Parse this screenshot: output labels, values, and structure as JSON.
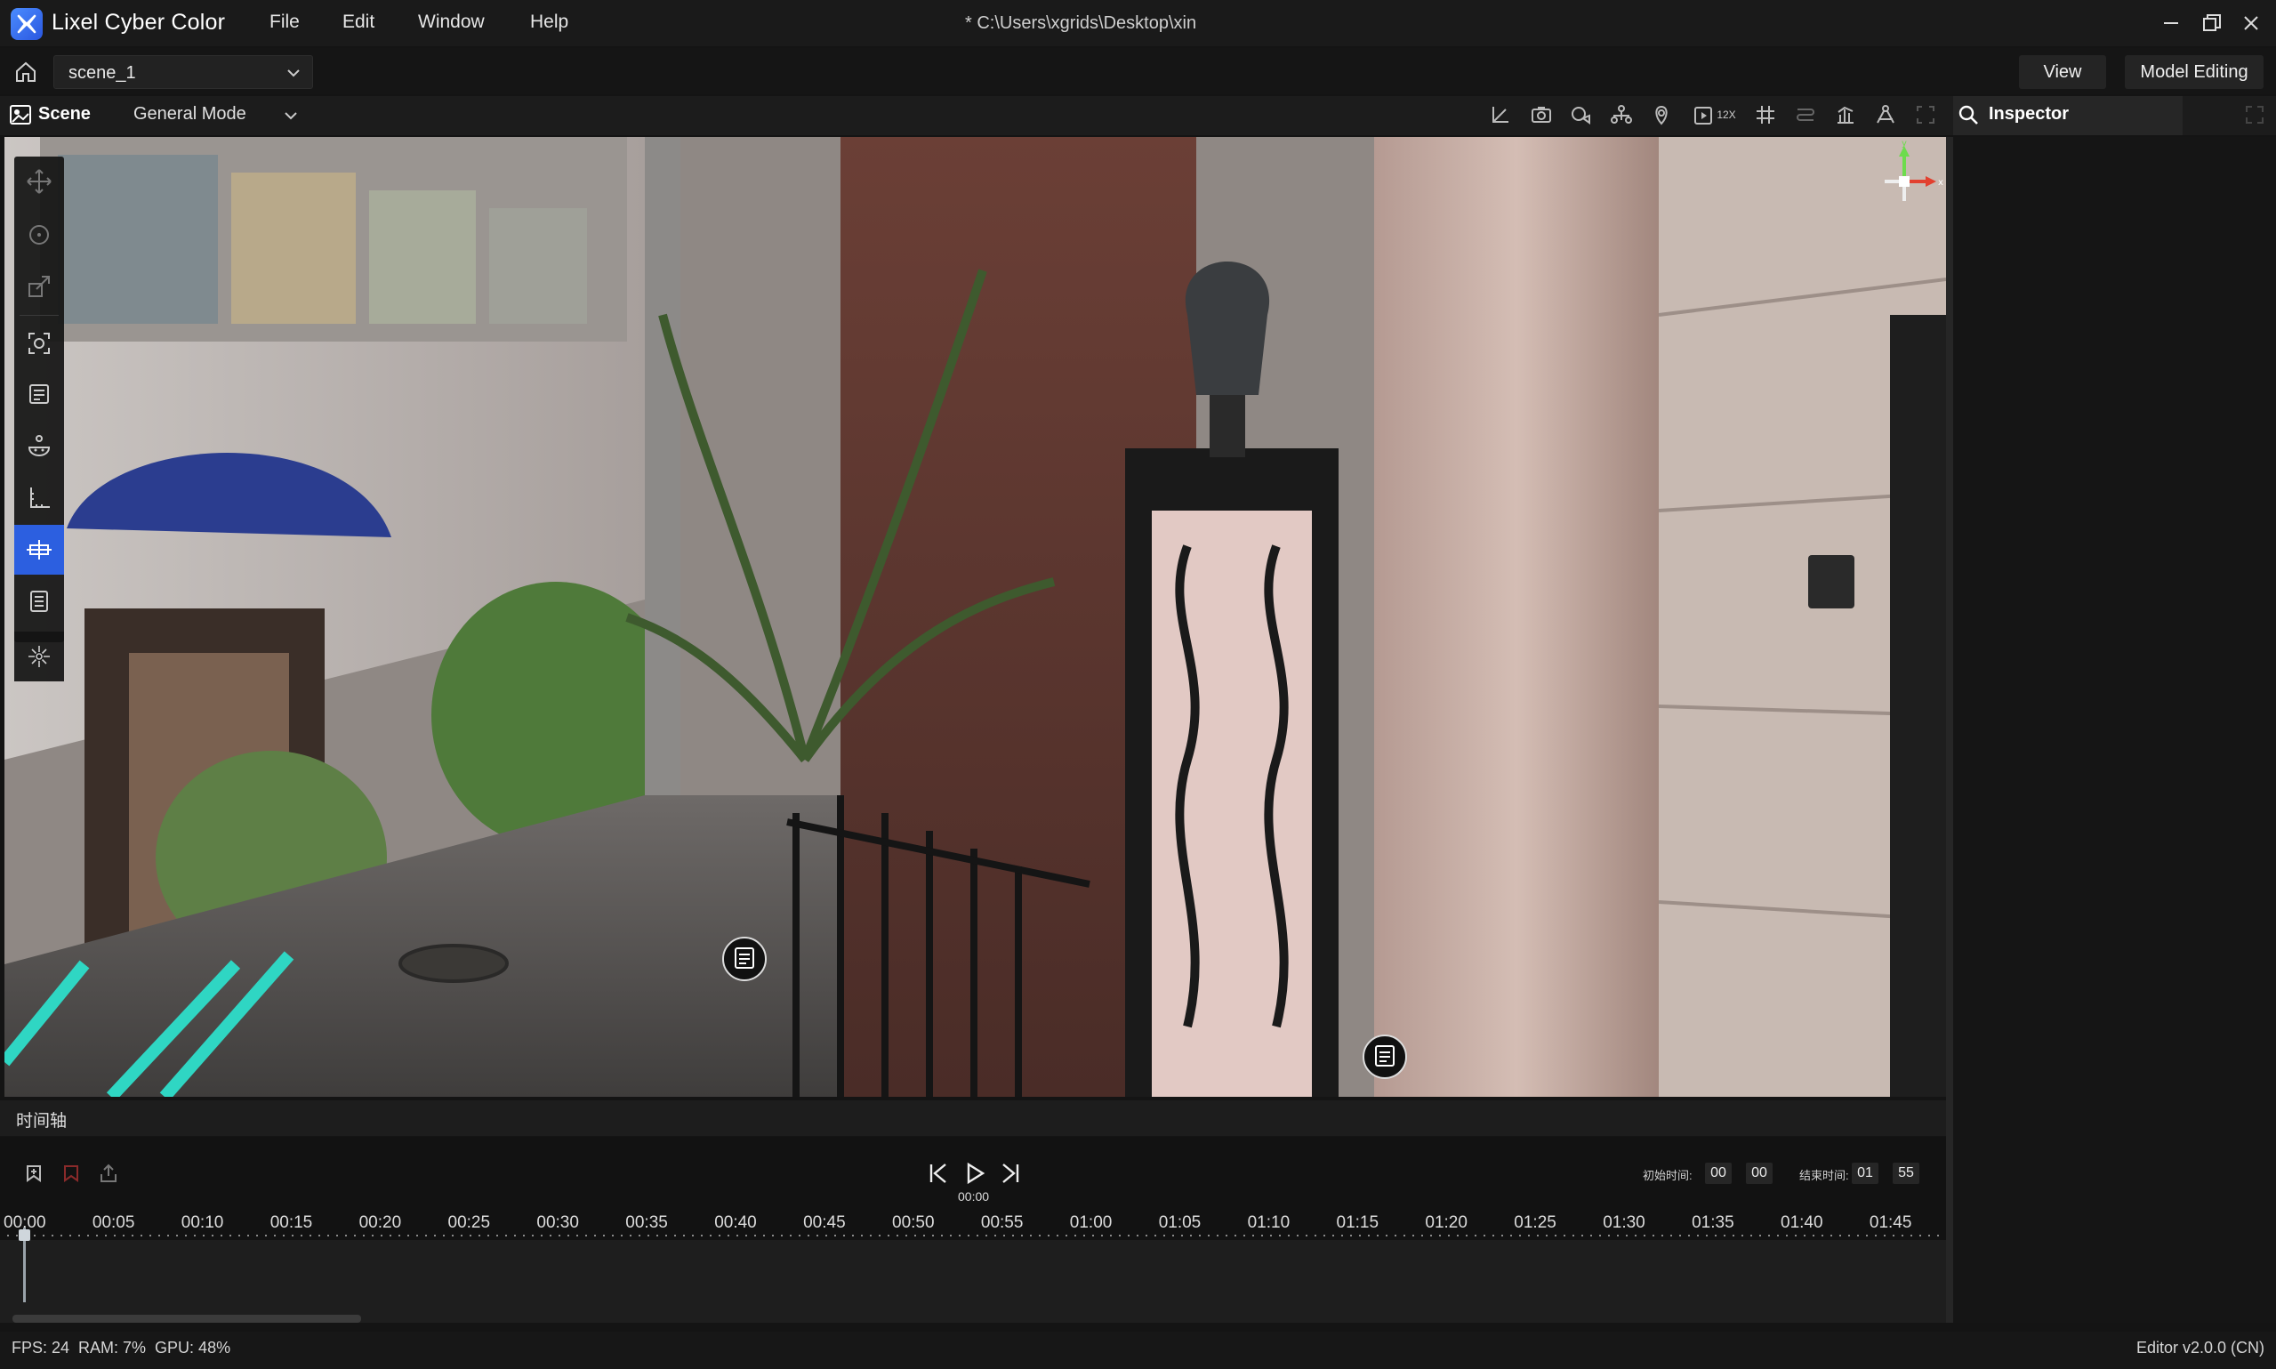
{
  "app": {
    "name": "Lixel Cyber Color"
  },
  "menu": [
    "File",
    "Edit",
    "Window",
    "Help"
  ],
  "file_path": "* C:\\Users\\xgrids\\Desktop\\xin",
  "scene_selector": {
    "value": "scene_1"
  },
  "top_buttons": {
    "view": "View",
    "model_editing": "Model Editing"
  },
  "panel": {
    "scene_tab": "Scene",
    "mode": "General Mode",
    "inspector": "Inspector"
  },
  "toolbar": {
    "speed_label": "12X"
  },
  "gizmo": {
    "y_label": "y",
    "x_label": "x"
  },
  "timeline": {
    "title": "时间轴",
    "current_time": "00:00",
    "start_label": "初始时间:",
    "start_min": "00",
    "start_sec": "00",
    "end_label": "结束时间:",
    "end_min": "01",
    "end_sec": "55",
    "ticks": [
      "00:00",
      "00:05",
      "00:10",
      "00:15",
      "00:20",
      "00:25",
      "00:30",
      "00:35",
      "00:40",
      "00:45",
      "00:50",
      "00:55",
      "01:00",
      "01:05",
      "01:10",
      "01:15",
      "01:20",
      "01:25",
      "01:30",
      "01:35",
      "01:40",
      "01:45"
    ]
  },
  "status": {
    "left": "FPS: 24  RAM: 7%  GPU: 48%",
    "right": "Editor v2.0.0 (CN)"
  }
}
